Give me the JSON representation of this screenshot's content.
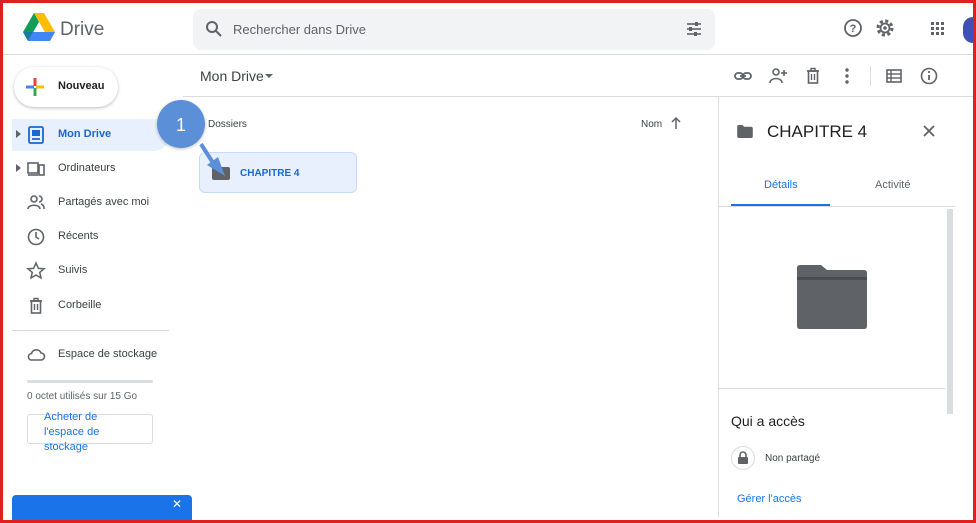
{
  "app": {
    "name": "Drive"
  },
  "search": {
    "placeholder": "Rechercher dans Drive"
  },
  "sidebar": {
    "new_label": "Nouveau",
    "items": [
      {
        "label": "Mon Drive",
        "icon": "my-drive-icon"
      },
      {
        "label": "Ordinateurs",
        "icon": "computers-icon"
      },
      {
        "label": "Partagés avec moi",
        "icon": "shared-icon"
      },
      {
        "label": "Récents",
        "icon": "clock-icon"
      },
      {
        "label": "Suivis",
        "icon": "star-icon"
      },
      {
        "label": "Corbeille",
        "icon": "trash-icon"
      }
    ],
    "storage_label": "Espace de stockage",
    "storage_used": 0,
    "storage_text": "0 octet utilisés sur 15 Go",
    "buy_label": "Acheter de l'espace de stockage"
  },
  "main": {
    "breadcrumb": "Mon Drive",
    "section_title": "Dossiers",
    "sort_label": "Nom",
    "folders": [
      {
        "name": "CHAPITRE 4"
      }
    ]
  },
  "callout": {
    "number": "1"
  },
  "details": {
    "title": "CHAPITRE 4",
    "tabs": [
      "Détails",
      "Activité"
    ],
    "access_title": "Qui a accès",
    "sharing_status": "Non partagé",
    "manage_label": "Gérer l'accès"
  },
  "colors": {
    "accent": "#1a73e8",
    "selected_bg": "#e8f0fe",
    "frame": "#e0201c",
    "callout": "#5b8fd8"
  }
}
